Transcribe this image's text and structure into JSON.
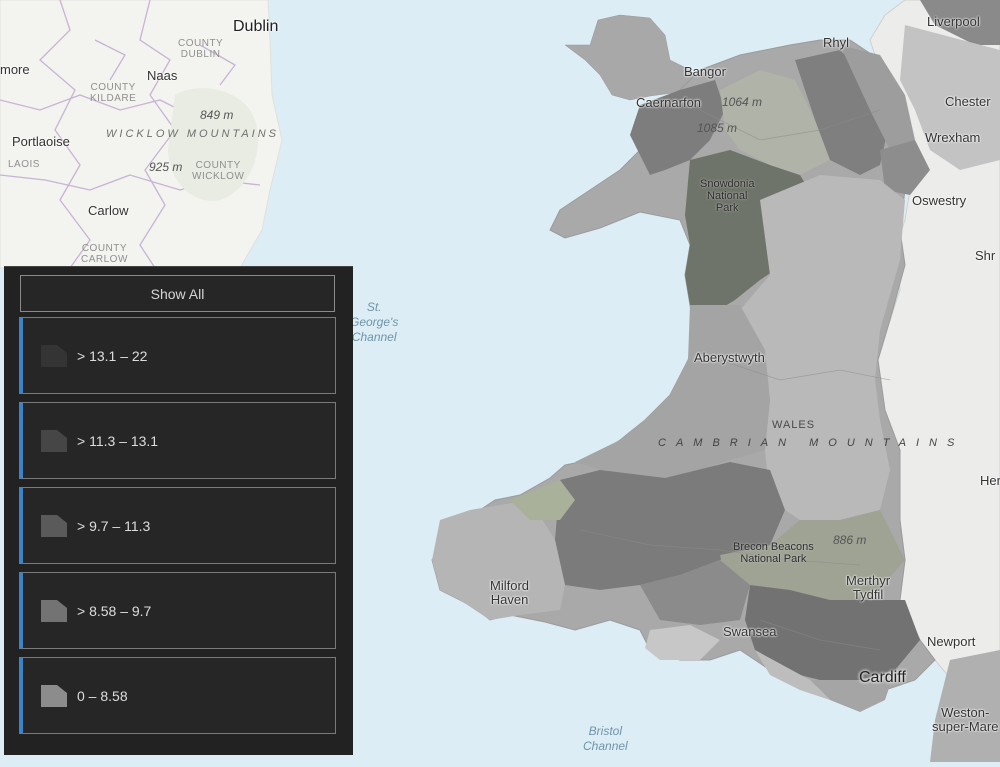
{
  "map": {
    "place_labels": {
      "dublin": "Dublin",
      "more": "more",
      "naas": "Naas",
      "portlaoise": "Portlaoise",
      "carlow": "Carlow",
      "liverpool": "Liverpool",
      "rhyl": "Rhyl",
      "bangor": "Bangor",
      "caernarfon": "Caernarfon",
      "chester": "Chester",
      "wrexham": "Wrexham",
      "oswestry": "Oswestry",
      "shr": "Shr",
      "aberystwyth": "Aberystwyth",
      "her": "Her",
      "milford_line1": "Milford",
      "milford_line2": "Haven",
      "merthyr_line1": "Merthyr",
      "merthyr_line2": "Tydfil",
      "swansea": "Swansea",
      "newport": "Newport",
      "cardiff": "Cardiff",
      "weston_line1": "Weston-",
      "weston_line2": "super-Mare"
    },
    "admin_labels": {
      "county_dublin_1": "COUNTY",
      "county_dublin_2": "DUBLIN",
      "county_kildare_1": "COUNTY",
      "county_kildare_2": "KILDARE",
      "laois": "LAOIS",
      "county_wicklow_1": "COUNTY",
      "county_wicklow_2": "WICKLOW",
      "county_carlow_1": "COUNTY",
      "county_carlow_2": "CARLOW",
      "wales": "WALES"
    },
    "water_labels": {
      "st_georges_1": "St.",
      "st_georges_2": "George's",
      "st_georges_3": "Channel",
      "bristol_1": "Bristol",
      "bristol_2": "Channel"
    },
    "terrain_labels": {
      "wicklow_mountains": "WICKLOW MOUNTAINS",
      "cambrian_mountains": "CAMBRIAN MOUNTAINS",
      "snowdonia_1": "Snowdonia",
      "snowdonia_2": "National",
      "snowdonia_3": "Park",
      "brecon_1": "Brecon Beacons",
      "brecon_2": "National Park"
    },
    "elevations": {
      "e849": "849 m",
      "e925": "925 m",
      "e1064": "1064 m",
      "e1085": "1085 m",
      "e886": "886 m"
    },
    "colors": {
      "sea": "#dcedf6",
      "land": "#f4f4f0",
      "region_darkest": "#6a6a6a",
      "region_dark": "#808080",
      "region_mid": "#9a9a9a",
      "region_light": "#b4b4b4",
      "region_lightest": "#c9c9c9",
      "park_green": "#a9b19a"
    }
  },
  "legend": {
    "show_all_label": "Show All",
    "items": [
      {
        "label": "> 13.1 – 22",
        "icon": "polygon-swatch-icon",
        "color": "#343434"
      },
      {
        "label": "> 11.3 – 13.1",
        "icon": "polygon-swatch-icon",
        "color": "#464646"
      },
      {
        "label": "> 9.7 – 11.3",
        "icon": "polygon-swatch-icon",
        "color": "#5a5a5a"
      },
      {
        "label": "> 8.58 – 9.7",
        "icon": "polygon-swatch-icon",
        "color": "#737373"
      },
      {
        "label": "0 – 8.58",
        "icon": "polygon-swatch-icon",
        "color": "#8c8c8c"
      }
    ],
    "accent_color": "#3c84c9"
  }
}
